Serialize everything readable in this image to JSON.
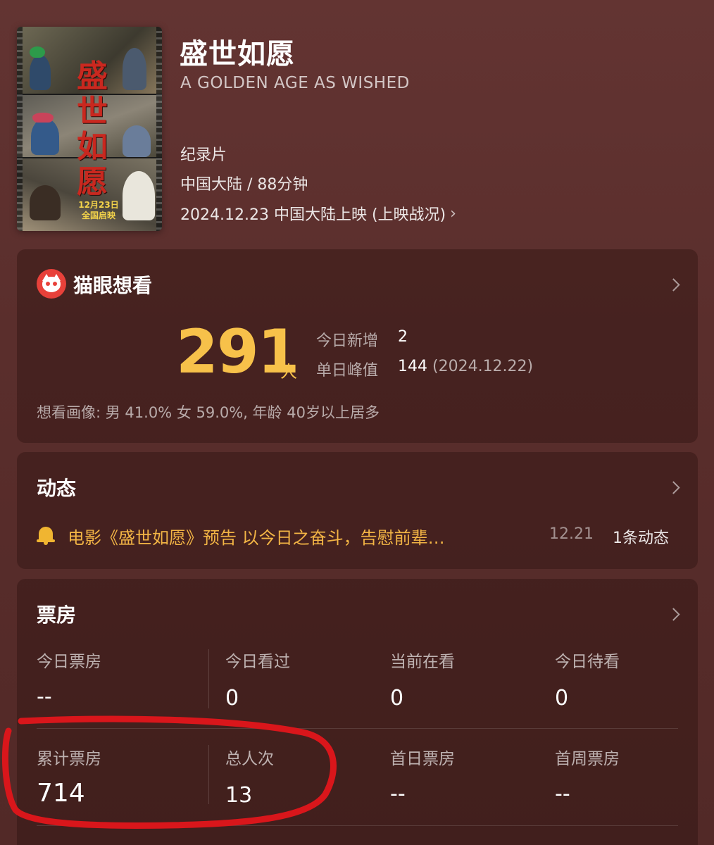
{
  "movie": {
    "title": "盛世如愿",
    "english_title": "A GOLDEN AGE AS WISHED",
    "genre": "纪录片",
    "region_duration": "中国大陆 / 88分钟",
    "release": "2024.12.23 中国大陆上映 (上映战况)",
    "release_chevron": "›"
  },
  "poster": {
    "title_chars": [
      "盛",
      "世",
      "如",
      "愿"
    ],
    "date_line1": "12月23日",
    "date_line2": "全国启映"
  },
  "wish": {
    "heading": "猫眼想看",
    "count": "291",
    "unit": "人",
    "today_label": "今日新增",
    "today_value": "2",
    "peak_label": "单日峰值",
    "peak_value": "144",
    "peak_date": "(2024.12.22)",
    "portrait": "想看画像: 男 41.0%  女 59.0%, 年龄 40岁以上居多"
  },
  "dynamics": {
    "heading": "动态",
    "news_text": "电影《盛世如愿》预告 以今日之奋斗，告慰前辈…",
    "news_date": "12.21",
    "news_count": "1条动态"
  },
  "box_office": {
    "heading": "票房",
    "row1": [
      {
        "label": "今日票房",
        "value": "--"
      },
      {
        "label": "今日看过",
        "value": "0"
      },
      {
        "label": "当前在看",
        "value": "0"
      },
      {
        "label": "今日待看",
        "value": "0"
      }
    ],
    "row2": [
      {
        "label": "累计票房",
        "value": "714"
      },
      {
        "label": "总人次",
        "value": "13"
      },
      {
        "label": "首日票房",
        "value": "--"
      },
      {
        "label": "首周票房",
        "value": "--"
      }
    ]
  },
  "colors": {
    "accent": "#f7c14a",
    "news": "#f3b545",
    "annotation": "#d9161b",
    "maoyan": "#e8413a"
  }
}
